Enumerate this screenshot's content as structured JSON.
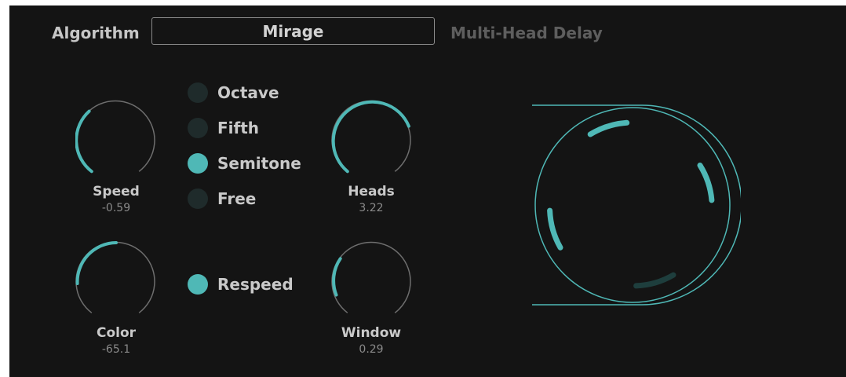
{
  "algorithm": {
    "label": "Algorithm",
    "value": "Mirage",
    "description": "Multi-Head Delay"
  },
  "knobs": {
    "speed": {
      "label": "Speed",
      "value": "-0.59"
    },
    "heads": {
      "label": "Heads",
      "value": "3.22"
    },
    "color": {
      "label": "Color",
      "value": "-65.1"
    },
    "window": {
      "label": "Window",
      "value": "0.29"
    }
  },
  "pitch_modes": [
    {
      "label": "Octave",
      "selected": false
    },
    {
      "label": "Fifth",
      "selected": false
    },
    {
      "label": "Semitone",
      "selected": true
    },
    {
      "label": "Free",
      "selected": false
    }
  ],
  "respeed": {
    "label": "Respeed",
    "enabled": true
  },
  "colors": {
    "accent": "#4fb8b6",
    "background": "#141414",
    "track": "#6e6e6e",
    "dot_off": "#1f2b2b"
  }
}
